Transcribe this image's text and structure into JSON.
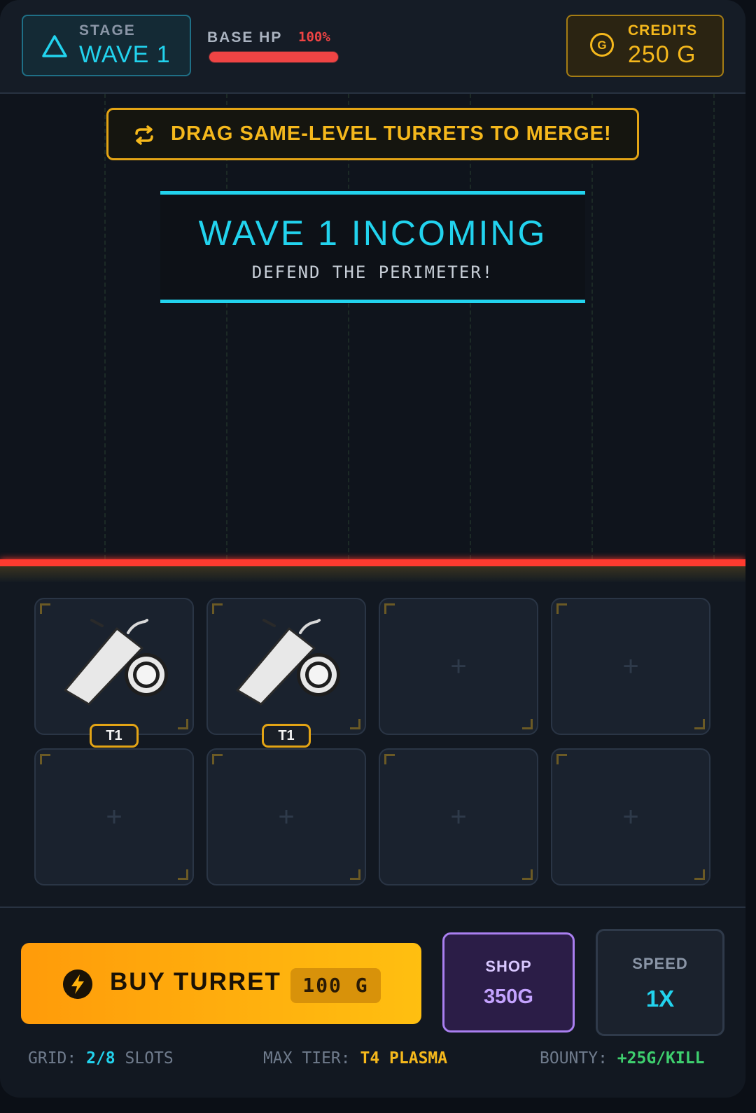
{
  "header": {
    "stage_label": "STAGE",
    "stage_value": "WAVE 1",
    "stage_icon": "triangle-icon",
    "base_hp_label": "BASE HP",
    "base_hp_percent": "100%",
    "base_hp_fraction": 1.0,
    "credits_label": "CREDITS",
    "credits_value": "250 G",
    "coin_glyph": "G"
  },
  "hint": {
    "icon": "merge-cycle-icon",
    "text": "DRAG SAME-LEVEL TURRETS TO MERGE!"
  },
  "wave_banner": {
    "title": "WAVE 1 INCOMING",
    "subtitle": "DEFEND THE PERIMETER!"
  },
  "grid": {
    "slots": [
      {
        "occupied": true,
        "tier": "T1"
      },
      {
        "occupied": true,
        "tier": "T1"
      },
      {
        "occupied": false,
        "placeholder": "+"
      },
      {
        "occupied": false,
        "placeholder": "+"
      },
      {
        "occupied": false,
        "placeholder": "+"
      },
      {
        "occupied": false,
        "placeholder": "+"
      },
      {
        "occupied": false,
        "placeholder": "+"
      },
      {
        "occupied": false,
        "placeholder": "+"
      }
    ]
  },
  "controls": {
    "buy_label": "BUY TURRET",
    "buy_price": "100 G",
    "shop_label": "SHOP",
    "shop_price": "350G",
    "speed_label": "SPEED",
    "speed_value": "1X"
  },
  "footer": {
    "grid_label": "GRID:",
    "grid_value": "2/8",
    "grid_suffix": "SLOTS",
    "max_tier_label": "MAX TIER:",
    "max_tier_value": "T4 PLASMA",
    "bounty_label": "BOUNTY:",
    "bounty_value": "+25G/KILL"
  },
  "colors": {
    "accent_cyan": "#22d3ee",
    "accent_gold": "#f5b81c",
    "danger_red": "#ef4444",
    "shop_purple": "#a97ff0",
    "bounty_green": "#3ecf6e"
  }
}
